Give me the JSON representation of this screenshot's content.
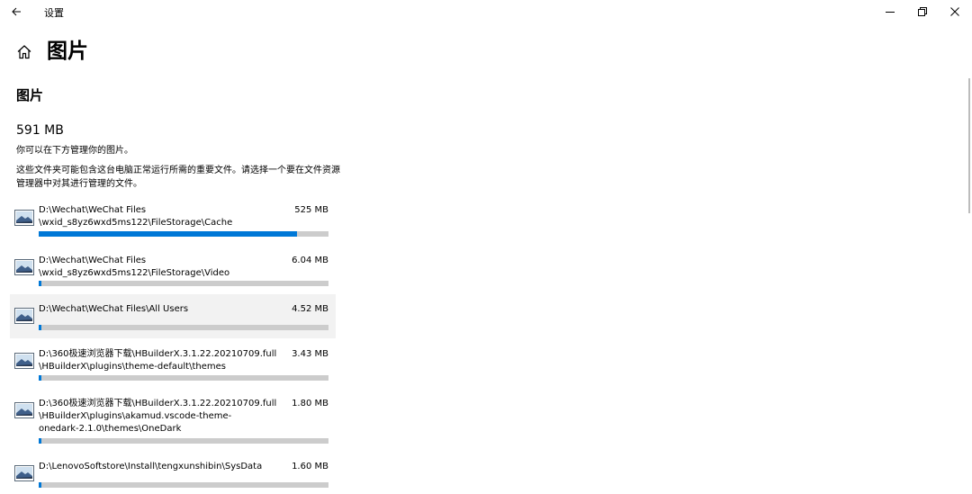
{
  "window": {
    "title": "设置",
    "icons": {
      "back": "back-arrow-icon",
      "minimize": "minimize-icon",
      "restore": "restore-icon",
      "close": "close-icon"
    }
  },
  "page": {
    "title": "图片",
    "home_icon": "home-icon"
  },
  "section": {
    "title": "图片",
    "total_size": "591 MB",
    "description": "你可以在下方管理你的图片。",
    "warning": "这些文件夹可能包含这台电脑正常运行所需的重要文件。请选择一个要在文件资源管理器中对其进行管理的文件。"
  },
  "folders": [
    {
      "path": "D:\\Wechat\\WeChat Files\n\\wxid_s8yz6wxd5ms122\\FileStorage\\Cache",
      "size": "525 MB",
      "usage": 0.89
    },
    {
      "path": "D:\\Wechat\\WeChat Files\n\\wxid_s8yz6wxd5ms122\\FileStorage\\Video",
      "size": "6.04 MB",
      "usage": 0.01
    },
    {
      "path": "D:\\Wechat\\WeChat Files\\All Users",
      "size": "4.52 MB",
      "usage": 0.008,
      "selected": true
    },
    {
      "path": "D:\\360极速浏览器下载\\HBuilderX.3.1.22.20210709.full\n\\HBuilderX\\plugins\\theme-default\\themes",
      "size": "3.43 MB",
      "usage": 0.006
    },
    {
      "path": "D:\\360极速浏览器下载\\HBuilderX.3.1.22.20210709.full\n\\HBuilderX\\plugins\\akamud.vscode-theme-\nonedark-2.1.0\\themes\\OneDark",
      "size": "1.80 MB",
      "usage": 0.004
    },
    {
      "path": "D:\\LenovoSoftstore\\Install\\tengxunshibin\\SysData",
      "size": "1.60 MB",
      "usage": 0.003
    }
  ],
  "colors": {
    "accent": "#0078d7",
    "track": "#cccccc",
    "selected_bg": "#f2f2f2"
  }
}
